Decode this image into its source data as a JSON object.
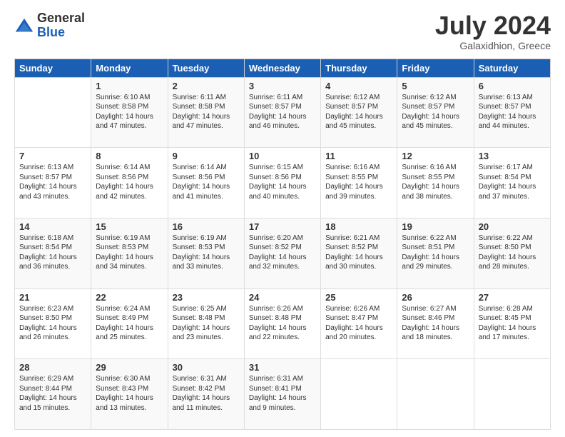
{
  "logo": {
    "general": "General",
    "blue": "Blue"
  },
  "title": "July 2024",
  "location": "Galaxidhion, Greece",
  "headers": [
    "Sunday",
    "Monday",
    "Tuesday",
    "Wednesday",
    "Thursday",
    "Friday",
    "Saturday"
  ],
  "weeks": [
    [
      {
        "day": "",
        "sunrise": "",
        "sunset": "",
        "daylight": ""
      },
      {
        "day": "1",
        "sunrise": "Sunrise: 6:10 AM",
        "sunset": "Sunset: 8:58 PM",
        "daylight": "Daylight: 14 hours and 47 minutes."
      },
      {
        "day": "2",
        "sunrise": "Sunrise: 6:11 AM",
        "sunset": "Sunset: 8:58 PM",
        "daylight": "Daylight: 14 hours and 47 minutes."
      },
      {
        "day": "3",
        "sunrise": "Sunrise: 6:11 AM",
        "sunset": "Sunset: 8:57 PM",
        "daylight": "Daylight: 14 hours and 46 minutes."
      },
      {
        "day": "4",
        "sunrise": "Sunrise: 6:12 AM",
        "sunset": "Sunset: 8:57 PM",
        "daylight": "Daylight: 14 hours and 45 minutes."
      },
      {
        "day": "5",
        "sunrise": "Sunrise: 6:12 AM",
        "sunset": "Sunset: 8:57 PM",
        "daylight": "Daylight: 14 hours and 45 minutes."
      },
      {
        "day": "6",
        "sunrise": "Sunrise: 6:13 AM",
        "sunset": "Sunset: 8:57 PM",
        "daylight": "Daylight: 14 hours and 44 minutes."
      }
    ],
    [
      {
        "day": "7",
        "sunrise": "Sunrise: 6:13 AM",
        "sunset": "Sunset: 8:57 PM",
        "daylight": "Daylight: 14 hours and 43 minutes."
      },
      {
        "day": "8",
        "sunrise": "Sunrise: 6:14 AM",
        "sunset": "Sunset: 8:56 PM",
        "daylight": "Daylight: 14 hours and 42 minutes."
      },
      {
        "day": "9",
        "sunrise": "Sunrise: 6:14 AM",
        "sunset": "Sunset: 8:56 PM",
        "daylight": "Daylight: 14 hours and 41 minutes."
      },
      {
        "day": "10",
        "sunrise": "Sunrise: 6:15 AM",
        "sunset": "Sunset: 8:56 PM",
        "daylight": "Daylight: 14 hours and 40 minutes."
      },
      {
        "day": "11",
        "sunrise": "Sunrise: 6:16 AM",
        "sunset": "Sunset: 8:55 PM",
        "daylight": "Daylight: 14 hours and 39 minutes."
      },
      {
        "day": "12",
        "sunrise": "Sunrise: 6:16 AM",
        "sunset": "Sunset: 8:55 PM",
        "daylight": "Daylight: 14 hours and 38 minutes."
      },
      {
        "day": "13",
        "sunrise": "Sunrise: 6:17 AM",
        "sunset": "Sunset: 8:54 PM",
        "daylight": "Daylight: 14 hours and 37 minutes."
      }
    ],
    [
      {
        "day": "14",
        "sunrise": "Sunrise: 6:18 AM",
        "sunset": "Sunset: 8:54 PM",
        "daylight": "Daylight: 14 hours and 36 minutes."
      },
      {
        "day": "15",
        "sunrise": "Sunrise: 6:19 AM",
        "sunset": "Sunset: 8:53 PM",
        "daylight": "Daylight: 14 hours and 34 minutes."
      },
      {
        "day": "16",
        "sunrise": "Sunrise: 6:19 AM",
        "sunset": "Sunset: 8:53 PM",
        "daylight": "Daylight: 14 hours and 33 minutes."
      },
      {
        "day": "17",
        "sunrise": "Sunrise: 6:20 AM",
        "sunset": "Sunset: 8:52 PM",
        "daylight": "Daylight: 14 hours and 32 minutes."
      },
      {
        "day": "18",
        "sunrise": "Sunrise: 6:21 AM",
        "sunset": "Sunset: 8:52 PM",
        "daylight": "Daylight: 14 hours and 30 minutes."
      },
      {
        "day": "19",
        "sunrise": "Sunrise: 6:22 AM",
        "sunset": "Sunset: 8:51 PM",
        "daylight": "Daylight: 14 hours and 29 minutes."
      },
      {
        "day": "20",
        "sunrise": "Sunrise: 6:22 AM",
        "sunset": "Sunset: 8:50 PM",
        "daylight": "Daylight: 14 hours and 28 minutes."
      }
    ],
    [
      {
        "day": "21",
        "sunrise": "Sunrise: 6:23 AM",
        "sunset": "Sunset: 8:50 PM",
        "daylight": "Daylight: 14 hours and 26 minutes."
      },
      {
        "day": "22",
        "sunrise": "Sunrise: 6:24 AM",
        "sunset": "Sunset: 8:49 PM",
        "daylight": "Daylight: 14 hours and 25 minutes."
      },
      {
        "day": "23",
        "sunrise": "Sunrise: 6:25 AM",
        "sunset": "Sunset: 8:48 PM",
        "daylight": "Daylight: 14 hours and 23 minutes."
      },
      {
        "day": "24",
        "sunrise": "Sunrise: 6:26 AM",
        "sunset": "Sunset: 8:48 PM",
        "daylight": "Daylight: 14 hours and 22 minutes."
      },
      {
        "day": "25",
        "sunrise": "Sunrise: 6:26 AM",
        "sunset": "Sunset: 8:47 PM",
        "daylight": "Daylight: 14 hours and 20 minutes."
      },
      {
        "day": "26",
        "sunrise": "Sunrise: 6:27 AM",
        "sunset": "Sunset: 8:46 PM",
        "daylight": "Daylight: 14 hours and 18 minutes."
      },
      {
        "day": "27",
        "sunrise": "Sunrise: 6:28 AM",
        "sunset": "Sunset: 8:45 PM",
        "daylight": "Daylight: 14 hours and 17 minutes."
      }
    ],
    [
      {
        "day": "28",
        "sunrise": "Sunrise: 6:29 AM",
        "sunset": "Sunset: 8:44 PM",
        "daylight": "Daylight: 14 hours and 15 minutes."
      },
      {
        "day": "29",
        "sunrise": "Sunrise: 6:30 AM",
        "sunset": "Sunset: 8:43 PM",
        "daylight": "Daylight: 14 hours and 13 minutes."
      },
      {
        "day": "30",
        "sunrise": "Sunrise: 6:31 AM",
        "sunset": "Sunset: 8:42 PM",
        "daylight": "Daylight: 14 hours and 11 minutes."
      },
      {
        "day": "31",
        "sunrise": "Sunrise: 6:31 AM",
        "sunset": "Sunset: 8:41 PM",
        "daylight": "Daylight: 14 hours and 9 minutes."
      },
      {
        "day": "",
        "sunrise": "",
        "sunset": "",
        "daylight": ""
      },
      {
        "day": "",
        "sunrise": "",
        "sunset": "",
        "daylight": ""
      },
      {
        "day": "",
        "sunrise": "",
        "sunset": "",
        "daylight": ""
      }
    ]
  ]
}
